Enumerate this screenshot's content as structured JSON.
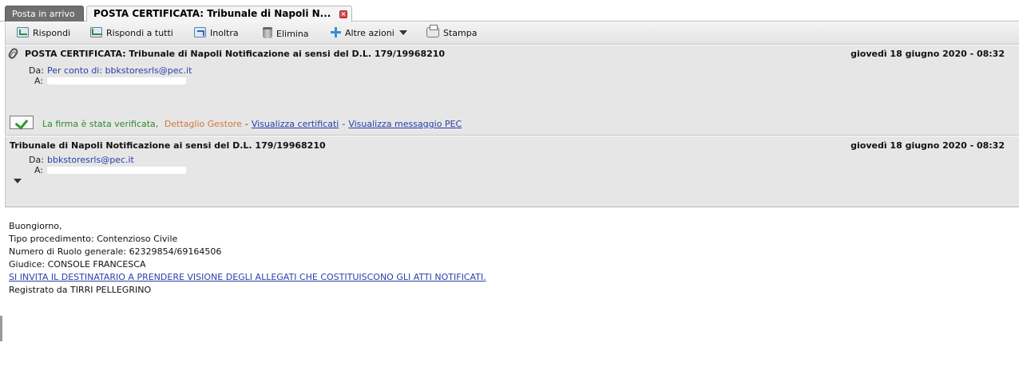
{
  "tabs": [
    {
      "label": "Posta in arrivo",
      "active": false
    },
    {
      "label": "POSTA CERTIFICATA: Tribunale di Napoli N...",
      "active": true
    }
  ],
  "toolbar": {
    "reply": "Rispondi",
    "reply_all": "Rispondi a tutti",
    "forward": "Inoltra",
    "delete": "Elimina",
    "more": "Altre azioni",
    "print": "Stampa"
  },
  "pec_header": {
    "subject": "POSTA CERTIFICATA: Tribunale di Napoli Notificazione ai sensi del D.L. 179/19968210",
    "date": "giovedì 18 giugno 2020 - 08:32",
    "from_label": "Da:",
    "from_prefix": "Per conto di:",
    "from_address": "bbkstoresrls@pec.it",
    "to_label": "A:",
    "signature_status": "La firma è stata verificata,",
    "provider_detail": "Dettaglio Gestore",
    "view_certificates": "Visualizza certificati",
    "view_pec_message": "Visualizza messaggio PEC",
    "separator": "-"
  },
  "inner_header": {
    "subject": "Tribunale di Napoli Notificazione ai sensi del D.L. 179/19968210",
    "date": "giovedì 18 giugno 2020 - 08:32",
    "from_label": "Da:",
    "from_address": "bbkstoresrls@pec.it",
    "to_label": "A:"
  },
  "body": {
    "greeting": "Buongiorno,",
    "line1": "Tipo procedimento: Contenzioso Civile",
    "line2": "Numero di Ruolo generale: 62329854/69164506",
    "line3": "Giudice: CONSOLE FRANCESCA",
    "link": "SI INVITA IL DESTINATARIO A PRENDERE VISIONE DEGLI ALLEGATI CHE COSTITUISCONO GLI ATTI NOTIFICATI.",
    "line4": "Registrato da TIRRI PELLEGRINO"
  },
  "colors": {
    "link": "#2a3fa8",
    "verified": "#2e8a2e",
    "provider": "#d07a3a",
    "tab_inactive": "#6f6f6f"
  }
}
